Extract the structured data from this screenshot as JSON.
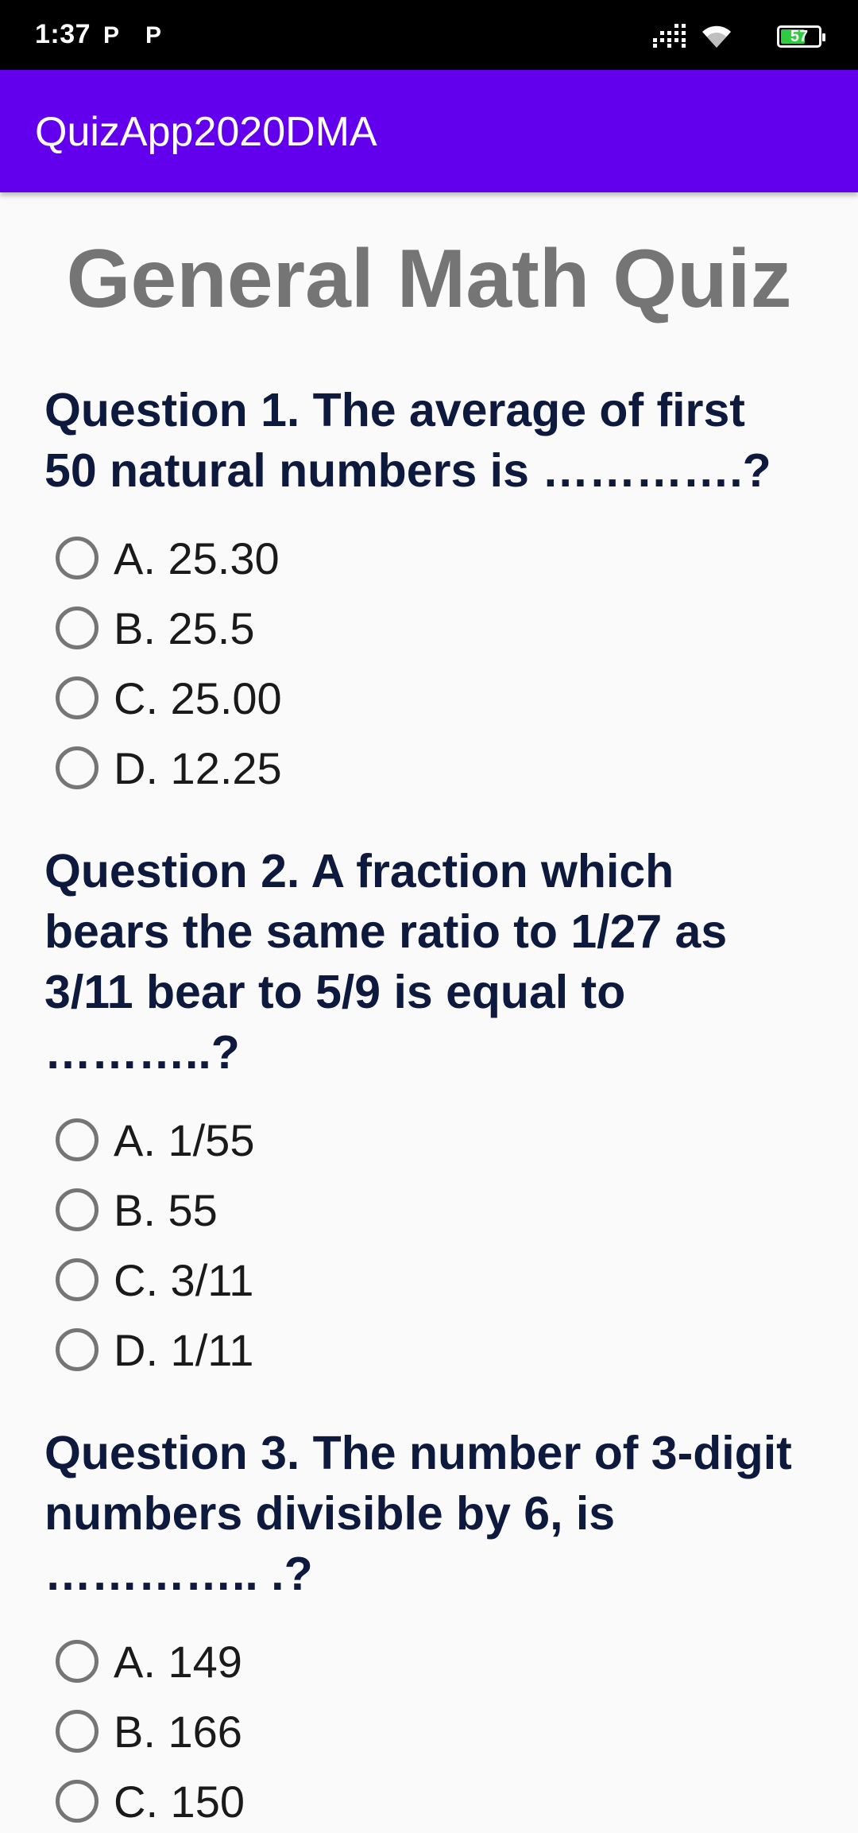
{
  "status_bar": {
    "time": "1:37",
    "notification_icons": [
      "P",
      "P"
    ],
    "battery_level": "57"
  },
  "app_bar": {
    "title": "QuizApp2020DMA"
  },
  "quiz": {
    "title": "General Math Quiz",
    "questions": [
      {
        "text": "Question 1. The average of first 50 natural numbers is ………….?",
        "options": [
          "A. 25.30",
          "B. 25.5",
          "C. 25.00",
          "D. 12.25"
        ]
      },
      {
        "text": "Question 2. A fraction which bears the same ratio to 1/27 as 3/11 bear to 5/9 is equal to ………..?",
        "options": [
          "A. 1/55",
          "B. 55",
          "C. 3/11",
          "D. 1/11"
        ]
      },
      {
        "text": "Question 3. The number of 3-digit numbers divisible by 6, is ………….. .?",
        "options": [
          "A. 149",
          "B. 166",
          "C. 150"
        ]
      }
    ]
  },
  "colors": {
    "app_bar": "#6200ee",
    "status_bar": "#000000",
    "title_text": "#757575",
    "question_text": "#0d1a3d",
    "battery_fill": "#2ecc40"
  }
}
